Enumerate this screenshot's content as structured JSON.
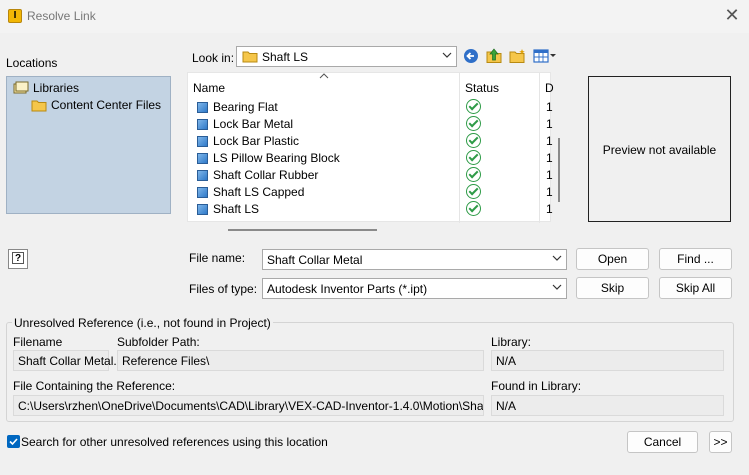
{
  "window": {
    "title": "Resolve Link",
    "app_icon_text": "I"
  },
  "locations": {
    "label": "Locations",
    "tree": [
      {
        "label": "Libraries",
        "icon": "libraries-icon"
      },
      {
        "label": "Content Center Files",
        "icon": "folder-icon"
      }
    ]
  },
  "lookin": {
    "label": "Look in:",
    "value": "Shaft LS"
  },
  "file_list": {
    "columns": {
      "name": "Name",
      "status": "Status",
      "date": "D"
    },
    "rows": [
      {
        "name": "Bearing Flat",
        "date": "1"
      },
      {
        "name": "Lock Bar Metal",
        "date": "1"
      },
      {
        "name": "Lock Bar Plastic",
        "date": "1"
      },
      {
        "name": "LS Pillow Bearing Block",
        "date": "1"
      },
      {
        "name": "Shaft Collar Rubber",
        "date": "1"
      },
      {
        "name": "Shaft LS Capped",
        "date": "1"
      },
      {
        "name": "Shaft LS",
        "date": "1"
      }
    ]
  },
  "preview": {
    "text": "Preview not available"
  },
  "filename": {
    "label": "File name:",
    "value": "Shaft Collar Metal"
  },
  "filetype": {
    "label": "Files of type:",
    "value": "Autodesk Inventor Parts (*.ipt)"
  },
  "buttons": {
    "open": "Open",
    "find": "Find ...",
    "skip": "Skip",
    "skip_all": "Skip All",
    "cancel": "Cancel",
    "more": ">>"
  },
  "unresolved": {
    "title": "Unresolved Reference (i.e., not found in Project)",
    "filename_label": "Filename",
    "filename_value": "Shaft Collar Metal.",
    "subfolder_label": "Subfolder Path:",
    "subfolder_value": "Reference Files\\",
    "library_label": "Library:",
    "library_value": "N/A",
    "containing_label": "File Containing the Reference:",
    "containing_value": "C:\\Users\\rzhen\\OneDrive\\Documents\\CAD\\Library\\VEX-CAD-Inventor-1.4.0\\Motion\\Shaft LS\\Sha",
    "found_label": "Found in Library:",
    "found_value": "N/A"
  },
  "search_option": {
    "label": "Search for other unresolved references using this location",
    "checked": true
  }
}
